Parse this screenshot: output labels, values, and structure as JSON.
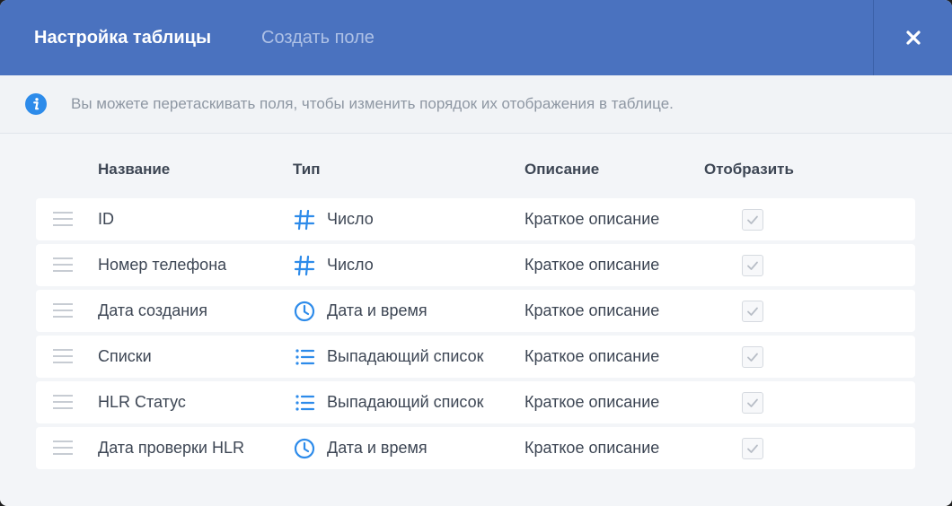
{
  "header": {
    "tab_active": "Настройка таблицы",
    "tab_inactive": "Создать поле",
    "close_icon": "close-icon"
  },
  "info": {
    "text": "Вы можете перетаскивать поля, чтобы изменить порядок их отображения в таблице.",
    "icon": "info-icon"
  },
  "columns": {
    "name": "Название",
    "type": "Тип",
    "description": "Описание",
    "show": "Отобразить"
  },
  "rows": [
    {
      "name": "ID",
      "type": "Число",
      "type_icon": "hash-icon",
      "description": "Краткое описание",
      "shown": true
    },
    {
      "name": "Номер телефона",
      "type": "Число",
      "type_icon": "hash-icon",
      "description": "Краткое описание",
      "shown": true
    },
    {
      "name": "Дата создания",
      "type": "Дата и время",
      "type_icon": "clock-icon",
      "description": "Краткое описание",
      "shown": true
    },
    {
      "name": "Списки",
      "type": "Выпадающий список",
      "type_icon": "list-icon",
      "description": "Краткое описание",
      "shown": true
    },
    {
      "name": "HLR Статус",
      "type": "Выпадающий список",
      "type_icon": "list-icon",
      "description": "Краткое описание",
      "shown": true
    },
    {
      "name": "Дата проверки HLR",
      "type": "Дата и время",
      "type_icon": "clock-icon",
      "description": "Краткое описание",
      "shown": true
    }
  ],
  "colors": {
    "header": "#4a72bf",
    "accent": "#2d8bea",
    "text": "#3d4654",
    "muted": "#8e97a3"
  }
}
